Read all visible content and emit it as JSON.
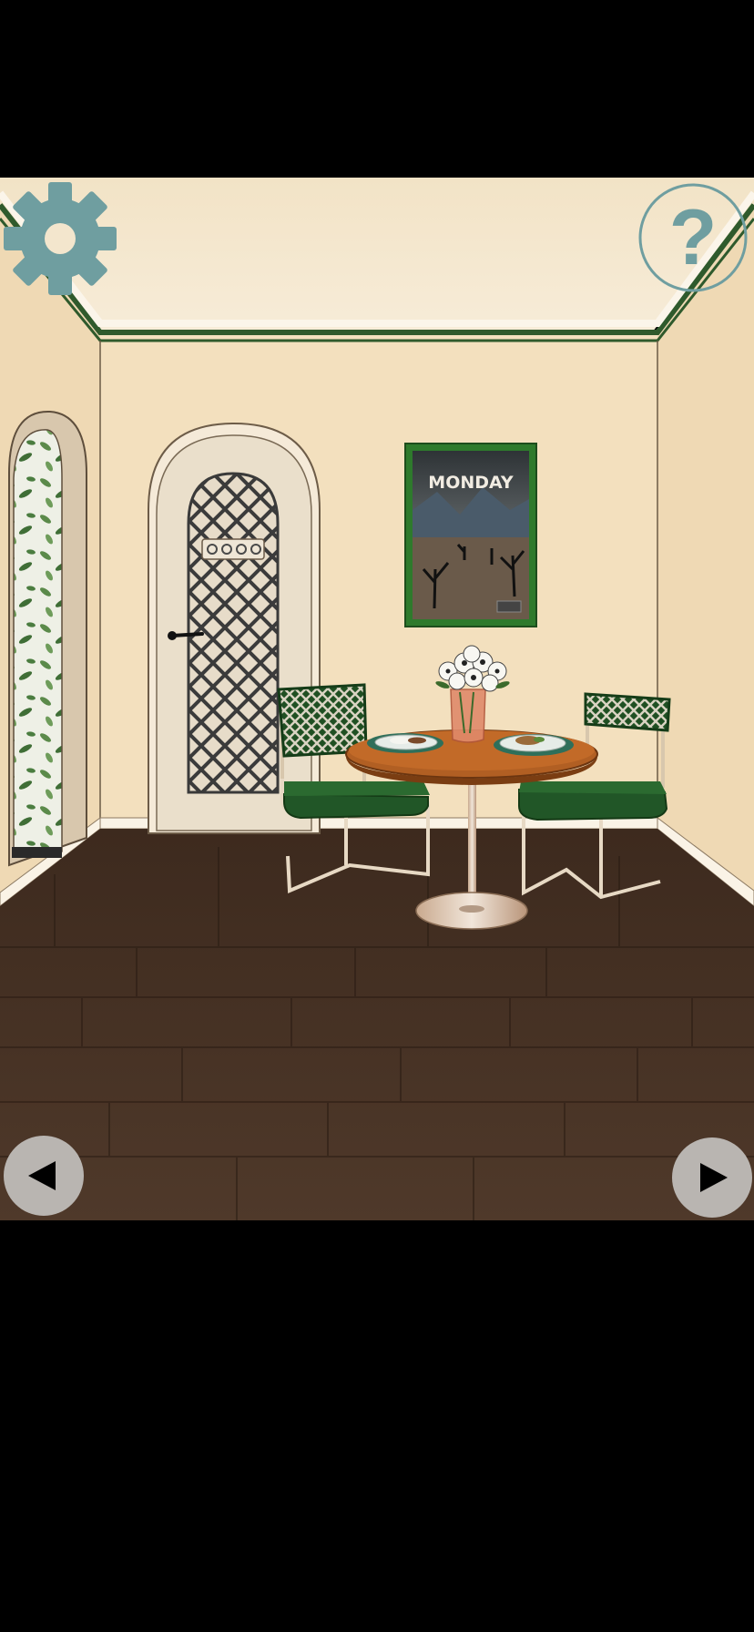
{
  "scene": {
    "room": "dining-room",
    "poster": {
      "text": "MONDAY"
    },
    "keypad_code": "0000"
  },
  "hud": {
    "settings_icon": "gear-icon",
    "help_icon": "question-mark-icon",
    "prev_icon": "arrow-left-icon",
    "next_icon": "arrow-right-icon",
    "help_glyph": "?",
    "colors": {
      "icon_teal": "#6f9ea0",
      "nav_gray": "#b9b5b1",
      "frame_green": "#2e6b2a",
      "chair_green": "#1f4f22"
    }
  }
}
